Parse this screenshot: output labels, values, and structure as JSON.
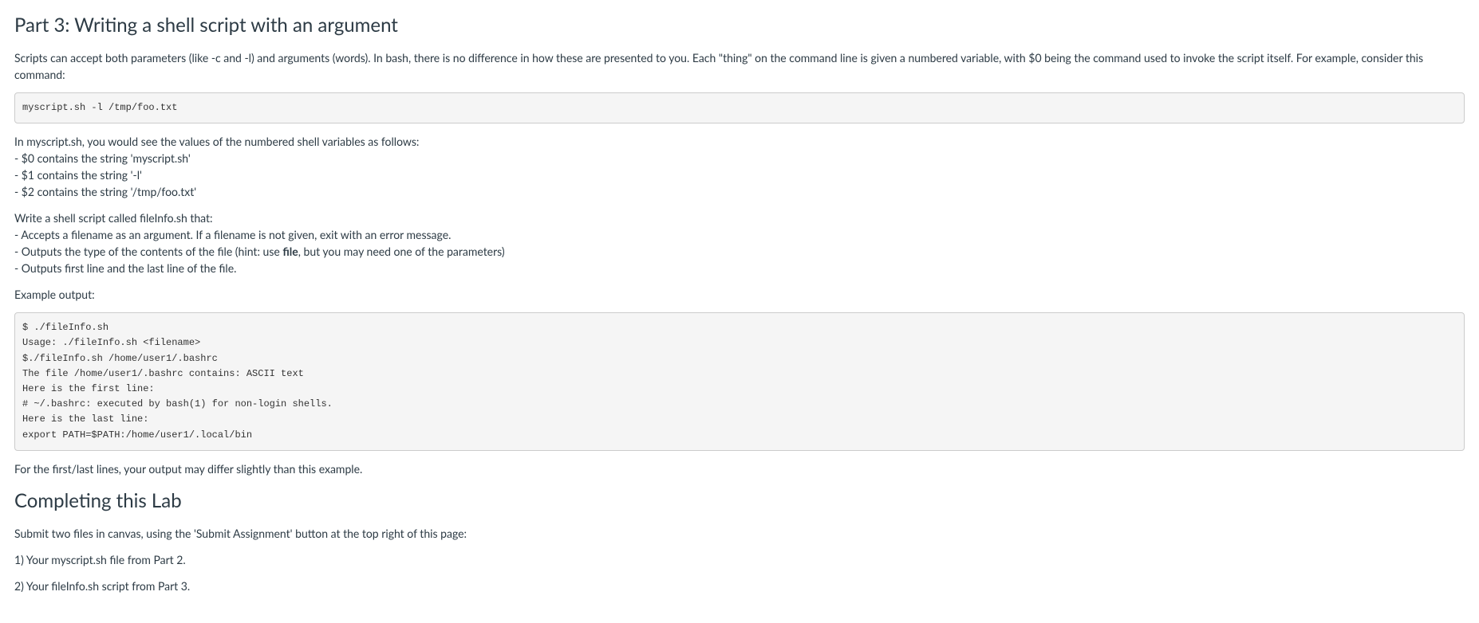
{
  "heading1": "Part 3: Writing a shell script with an argument",
  "intro_para": "Scripts can accept both parameters (like -c and -l) and arguments (words). In bash, there is no difference in how these are presented to you. Each \"thing\" on the command line is given a numbered variable, with $0 being the command used to invoke the script itself. For example, consider this command:",
  "code1": "myscript.sh -l /tmp/foo.txt",
  "vars_intro": "In myscript.sh, you would see the values of the numbered shell variables as follows:",
  "var0": "- $0 contains the string 'myscript.sh'",
  "var1": "- $1 contains the string '-l'",
  "var2": "- $2 contains the string '/tmp/foo.txt'",
  "task_intro": "Write a shell script called fileInfo.sh that:",
  "task1": "- Accepts a filename as an argument.  If a filename is not given, exit with an error message.",
  "task2_pre": "- Outputs the type of the contents of the file (hint: use ",
  "task2_bold": "file",
  "task2_post": ", but you may need one of the parameters)",
  "task3": "- Outputs first line and the last line of the file.",
  "example_label": "Example output:",
  "code2": "$ ./fileInfo.sh\nUsage: ./fileInfo.sh <filename>\n$./fileInfo.sh /home/user1/.bashrc\nThe file /home/user1/.bashrc contains: ASCII text\nHere is the first line:\n# ~/.bashrc: executed by bash(1) for non-login shells.\nHere is the last line:\nexport PATH=$PATH:/home/user1/.local/bin",
  "note": "For the first/last lines, your output may differ slightly than this example.",
  "heading2": "Completing this Lab",
  "submit_intro": "Submit two files in canvas, using the 'Submit Assignment' button at the top right of this page:",
  "submit1": "1) Your myscript.sh file from Part 2.",
  "submit2": "2) Your fileInfo.sh script from Part 3."
}
